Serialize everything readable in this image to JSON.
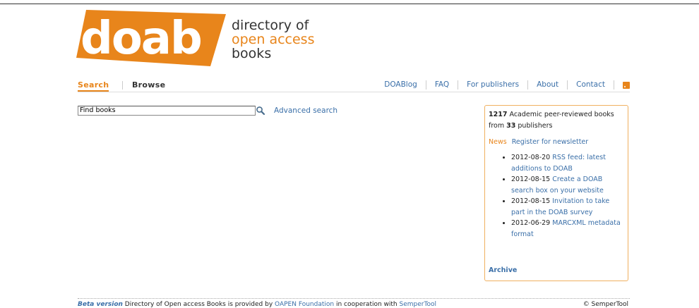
{
  "logo": {
    "wordmark": "doab",
    "tagline_1": "directory of",
    "tagline_2": "open access",
    "tagline_3": "books",
    "color": "#e8851b"
  },
  "nav": {
    "tabs": [
      {
        "label": "Search",
        "active": true
      },
      {
        "label": "Browse",
        "active": false
      }
    ],
    "links": [
      "DOABlog",
      "FAQ",
      "For publishers",
      "About",
      "Contact"
    ],
    "rss_icon": "rss-icon"
  },
  "search": {
    "value": "Find books",
    "button_icon": "search-icon",
    "advanced_label": "Advanced search"
  },
  "sidebar": {
    "count_books": "1217",
    "count_text": "Academic peer-reviewed books from",
    "count_publishers": "33",
    "publishers_text": "publishers",
    "news_label": "News",
    "newsletter_link": "Register for newsletter",
    "news": [
      {
        "date": "2012-08-20",
        "title": "RSS feed: latest additions to DOAB"
      },
      {
        "date": "2012-08-15",
        "title": "Create a DOAB search box on your website"
      },
      {
        "date": "2012-08-15",
        "title": "Invitation to take part in the DOAB survey"
      },
      {
        "date": "2012-06-29",
        "title": "MARCXML metadata format"
      }
    ],
    "archive_label": "Archive"
  },
  "footer": {
    "beta": "Beta version",
    "text_1": "Directory of Open access Books is provided by",
    "link_oapen": "OAPEN Foundation",
    "text_2": "in cooperation with",
    "link_semper": "SemperTool",
    "copyright": "© SemperTool"
  }
}
